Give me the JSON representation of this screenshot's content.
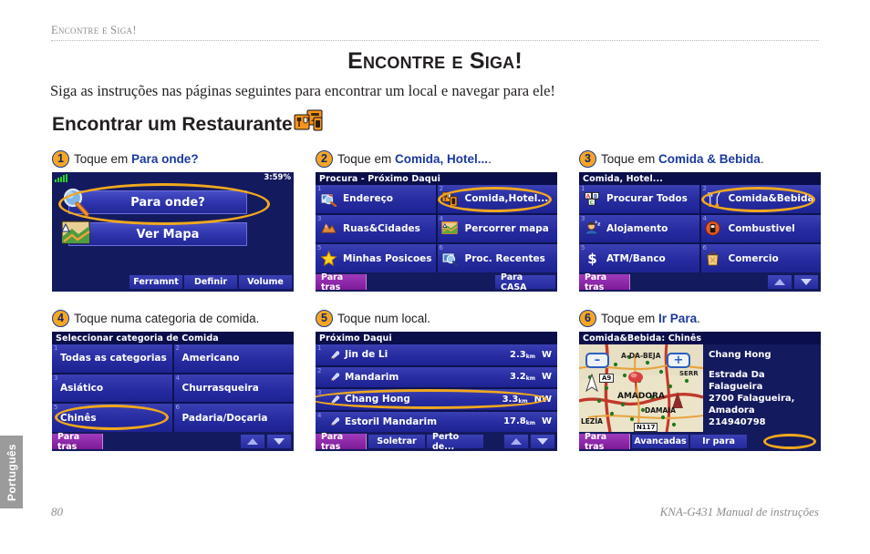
{
  "running_head": "Encontre e Siga!",
  "page_title": "Encontre e Siga!",
  "intro": "Siga as instruções nas páginas seguintes para encontrar um local e navegar para ele!",
  "section_heading": "Encontrar um Restaurante",
  "section_heading_icon": "restaurant-fuel-icon",
  "side_tab": "Português",
  "footer": {
    "page_number": "80",
    "manual": "KNA-G431 Manual de instruções"
  },
  "accent_color": "#f0a81e",
  "link_color": "#1b3a9e",
  "steps": [
    {
      "number": "1",
      "caption_prefix": "Toque em ",
      "caption_strong": "Para onde?",
      "caption_suffix": "",
      "screen": {
        "kind": "main-menu",
        "clock": "3:59",
        "battery": "%",
        "signal_icon": "signal-bars-icon",
        "buttons": [
          {
            "label": "Para onde?",
            "icon": "magnifier-icon",
            "highlighted": true
          },
          {
            "label": "Ver Mapa",
            "icon": "map-icon",
            "highlighted": false
          }
        ],
        "footer_buttons": [
          {
            "label": "Ferramnt"
          },
          {
            "label": "Definir"
          },
          {
            "label": "Volume"
          }
        ]
      }
    },
    {
      "number": "2",
      "caption_prefix": "Toque em ",
      "caption_strong": "Comida, Hotel...",
      "caption_suffix": ".",
      "screen": {
        "kind": "menu-grid",
        "title": "Procura - Próximo Daqui",
        "cells": [
          {
            "index": "1",
            "label": "Endereço",
            "icon": "address-search-icon",
            "highlighted": false
          },
          {
            "index": "2",
            "label": "Comida,Hotel...",
            "icon": "food-hotel-icon",
            "highlighted": true
          },
          {
            "index": "3",
            "label": "Ruas&Cidades",
            "icon": "streets-cities-icon",
            "highlighted": false
          },
          {
            "index": "4",
            "label": "Percorrer mapa",
            "icon": "browse-map-icon",
            "highlighted": false
          },
          {
            "index": "5",
            "label": "Minhas Posicoes",
            "icon": "star-icon",
            "highlighted": false
          },
          {
            "index": "6",
            "label": "Proc. Recentes",
            "icon": "recent-search-icon",
            "highlighted": false
          }
        ],
        "footer_buttons": [
          {
            "label": "Para tras",
            "style": "back"
          },
          {
            "label": "Para CASA",
            "style": "home"
          }
        ]
      }
    },
    {
      "number": "3",
      "caption_prefix": "Toque em ",
      "caption_strong": "Comida & Bebida",
      "caption_suffix": ".",
      "screen": {
        "kind": "menu-grid",
        "title": "Comida, Hotel...",
        "cells": [
          {
            "index": "1",
            "label": "Procurar Todos",
            "icon": "abc-blocks-icon",
            "highlighted": false
          },
          {
            "index": "2",
            "label": "Comida&Bebida",
            "icon": "food-drink-icon",
            "highlighted": true
          },
          {
            "index": "3",
            "label": "Alojamento",
            "icon": "lodging-icon",
            "highlighted": false
          },
          {
            "index": "4",
            "label": "Combustivel",
            "icon": "fuel-pump-icon",
            "highlighted": false
          },
          {
            "index": "5",
            "label": "ATM/Banco",
            "icon": "dollar-icon",
            "highlighted": false
          },
          {
            "index": "6",
            "label": "Comercio",
            "icon": "shopping-bag-icon",
            "highlighted": false
          }
        ],
        "footer_buttons": [
          {
            "label": "Para tras",
            "style": "back"
          }
        ],
        "scroll_arrows": true
      }
    },
    {
      "number": "4",
      "caption_prefix": "Toque numa categoria de comida.",
      "caption_strong": "",
      "caption_suffix": "",
      "screen": {
        "kind": "menu-grid",
        "title": "Seleccionar categoria de Comida",
        "cells": [
          {
            "index": "1",
            "label": "Todas as categorias",
            "icon": "",
            "highlighted": false
          },
          {
            "index": "2",
            "label": "Americano",
            "icon": "",
            "highlighted": false
          },
          {
            "index": "3",
            "label": "Asiático",
            "icon": "",
            "highlighted": false
          },
          {
            "index": "4",
            "label": "Churrasqueira",
            "icon": "",
            "highlighted": false
          },
          {
            "index": "5",
            "label": "Chinês",
            "icon": "",
            "highlighted": true
          },
          {
            "index": "6",
            "label": "Padaria/Doçaria",
            "icon": "",
            "highlighted": false
          }
        ],
        "footer_buttons": [
          {
            "label": "Para tras",
            "style": "back"
          }
        ],
        "scroll_arrows": true
      }
    },
    {
      "number": "5",
      "caption_prefix": "Toque num local.",
      "caption_strong": "",
      "caption_suffix": "",
      "screen": {
        "kind": "result-list",
        "title": "Próximo Daqui",
        "rows": [
          {
            "index": "1",
            "name": "Jin de Li",
            "distance": "2.3",
            "unit": "km",
            "bearing": "W",
            "icon": "restaurant-pin-icon",
            "highlighted": false
          },
          {
            "index": "2",
            "name": "Mandarim",
            "distance": "3.2",
            "unit": "km",
            "bearing": "W",
            "icon": "restaurant-pin-icon",
            "highlighted": false
          },
          {
            "index": "3",
            "name": "Chang Hong",
            "distance": "3.3",
            "unit": "km",
            "bearing": "NW",
            "icon": "restaurant-pin-icon",
            "highlighted": true
          },
          {
            "index": "4",
            "name": "Estoril Mandarim",
            "distance": "17.8",
            "unit": "km",
            "bearing": "W",
            "icon": "restaurant-pin-icon",
            "highlighted": false
          }
        ],
        "footer_buttons": [
          {
            "label": "Para tras",
            "style": "back"
          },
          {
            "label": "Soletrar",
            "style": "normal"
          },
          {
            "label": "Perto de...",
            "style": "normal"
          }
        ],
        "scroll_arrows": true
      }
    },
    {
      "number": "6",
      "caption_prefix": "Toque em ",
      "caption_strong": "Ir Para",
      "caption_suffix": ".",
      "screen": {
        "kind": "detail-map",
        "title": "Comida&Bebida: Chinês",
        "map": {
          "zoom_out_label": "–",
          "zoom_in_label": "+",
          "road_labels": [
            "A-DA-BEJA",
            "A9",
            "SERR",
            "AMADORA",
            "DAMAIA",
            "LEZÍA",
            "N117"
          ],
          "compass_icon": "north-arrow-icon",
          "pin_icon": "map-pin-icon"
        },
        "info": {
          "name": "Chang Hong",
          "address_line1": "Estrada Da Falagueira",
          "address_line2": "2700 Falagueira,",
          "address_line3": "Amadora",
          "phone": "214940798"
        },
        "footer_buttons": [
          {
            "label": "Para tras",
            "style": "back"
          },
          {
            "label": "Avancadas",
            "style": "normal"
          },
          {
            "label": "Ir para",
            "style": "normal",
            "highlighted": true
          }
        ]
      }
    }
  ]
}
